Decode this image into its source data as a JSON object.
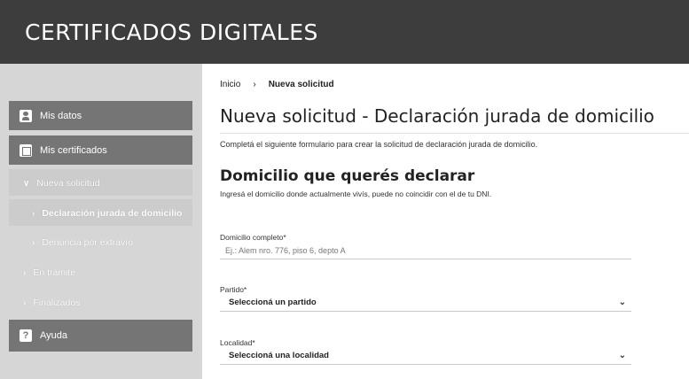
{
  "app": {
    "title": "CERTIFICADOS DIGITALES"
  },
  "sidebar": {
    "mis_datos": {
      "label": "Mis datos",
      "icon": "user-card-icon"
    },
    "mis_certificados": {
      "label": "Mis certificados",
      "icon": "certificate-icon"
    },
    "nueva_solicitud": {
      "label": "Nueva solicitud",
      "arrow": "∨"
    },
    "declaracion": {
      "label": "Declaración jurada de domicilio",
      "arrow": "›"
    },
    "denuncia": {
      "label": "Denuncia por extravío",
      "arrow": "›"
    },
    "en_tramite": {
      "label": "En trámite",
      "arrow": "›"
    },
    "finalizados": {
      "label": "Finalizados",
      "arrow": "›"
    },
    "ayuda": {
      "label": "Ayuda",
      "icon": "help-icon",
      "glyph": "?"
    }
  },
  "breadcrumb": {
    "home": "Inicio",
    "separator": "›",
    "current": "Nueva solicitud"
  },
  "main": {
    "title": "Nueva solicitud - Declaración jurada de domicilio",
    "intro": "Completá el siguiente formulario para crear la solicitud de declaración jurada de domicilio.",
    "section_title": "Domicilio que querés declarar",
    "section_sub": "Ingresá el domicilio donde actualmente vivís, puede no coincidir con el de tu DNI."
  },
  "form": {
    "domicilio": {
      "label": "Domicilio completo*",
      "placeholder": "Ej.: Alem nro. 776, piso 6, depto A",
      "value": ""
    },
    "partido": {
      "label": "Partido*",
      "selected": "Seleccioná un partido",
      "chevron": "⌄"
    },
    "localidad": {
      "label": "Localidad*",
      "selected": "Seleccioná una localidad",
      "chevron": "⌄"
    }
  },
  "colors": {
    "header_bg": "#3d3d3d",
    "sidebar_bg": "#d6d6d6",
    "sidebar_block": "#757575"
  }
}
